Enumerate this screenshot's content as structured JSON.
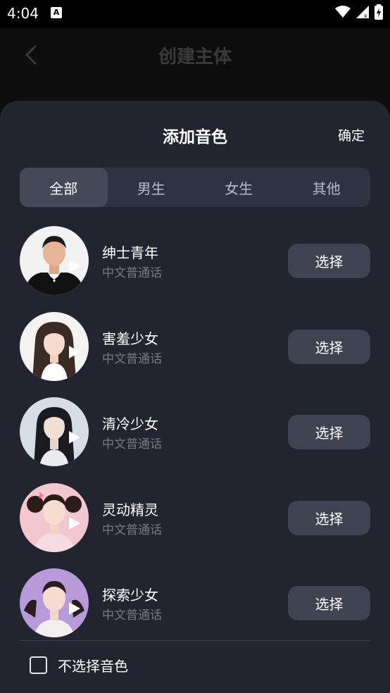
{
  "status_bar": {
    "time": "4:04",
    "notification_badge": "A",
    "icons": [
      "wifi-icon",
      "signal-icon",
      "battery-icon"
    ]
  },
  "background_page": {
    "title": "创建主体"
  },
  "sheet": {
    "title": "添加音色",
    "confirm_label": "确定",
    "tabs": [
      {
        "label": "全部",
        "active": true
      },
      {
        "label": "男生",
        "active": false
      },
      {
        "label": "女生",
        "active": false
      },
      {
        "label": "其他",
        "active": false
      }
    ],
    "voices": [
      {
        "name": "绅士青年",
        "language": "中文普通话",
        "button": "选择",
        "avatar_bg": "#f2f2f2",
        "hair": "#1a1a1a",
        "outfit": "#111111"
      },
      {
        "name": "害羞少女",
        "language": "中文普通话",
        "button": "选择",
        "avatar_bg": "#f5f3f2",
        "hair": "#3a2b25",
        "outfit": "#ffffff"
      },
      {
        "name": "清冷少女",
        "language": "中文普通话",
        "button": "选择",
        "avatar_bg": "#d6dde4",
        "hair": "#1a1a20",
        "outfit": "#e9ecef"
      },
      {
        "name": "灵动精灵",
        "language": "中文普通话",
        "button": "选择",
        "avatar_bg": "#f3c7cf",
        "hair": "#2b1c18",
        "outfit": "#f6dbe3"
      },
      {
        "name": "探索少女",
        "language": "中文普通话",
        "button": "选择",
        "avatar_bg": "#b89ad8",
        "hair": "#2a1d22",
        "outfit": "#f4eef2"
      }
    ],
    "no_voice_label": "不选择音色",
    "no_voice_checked": false
  },
  "colors": {
    "sheet_bg": "#22242f",
    "tab_bar_bg": "#2f3240",
    "tab_active_bg": "#454856",
    "button_bg": "#3f4250",
    "secondary_text": "#777a86"
  }
}
